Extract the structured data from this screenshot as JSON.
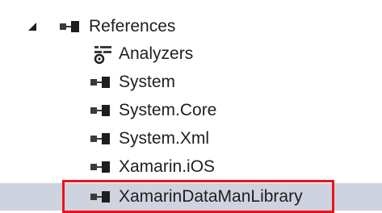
{
  "tree": {
    "references_label": "References",
    "items": [
      {
        "label": "Analyzers",
        "icon": "analyzer-icon"
      },
      {
        "label": "System",
        "icon": "reference-icon"
      },
      {
        "label": "System.Core",
        "icon": "reference-icon"
      },
      {
        "label": "System.Xml",
        "icon": "reference-icon"
      },
      {
        "label": "Xamarin.iOS",
        "icon": "reference-icon"
      },
      {
        "label": "XamarinDataManLibrary",
        "icon": "reference-icon",
        "selected": true
      }
    ]
  },
  "colors": {
    "selection_background": "#cfd3df",
    "highlight_border": "#e8141c",
    "text": "#1e1e1e"
  }
}
